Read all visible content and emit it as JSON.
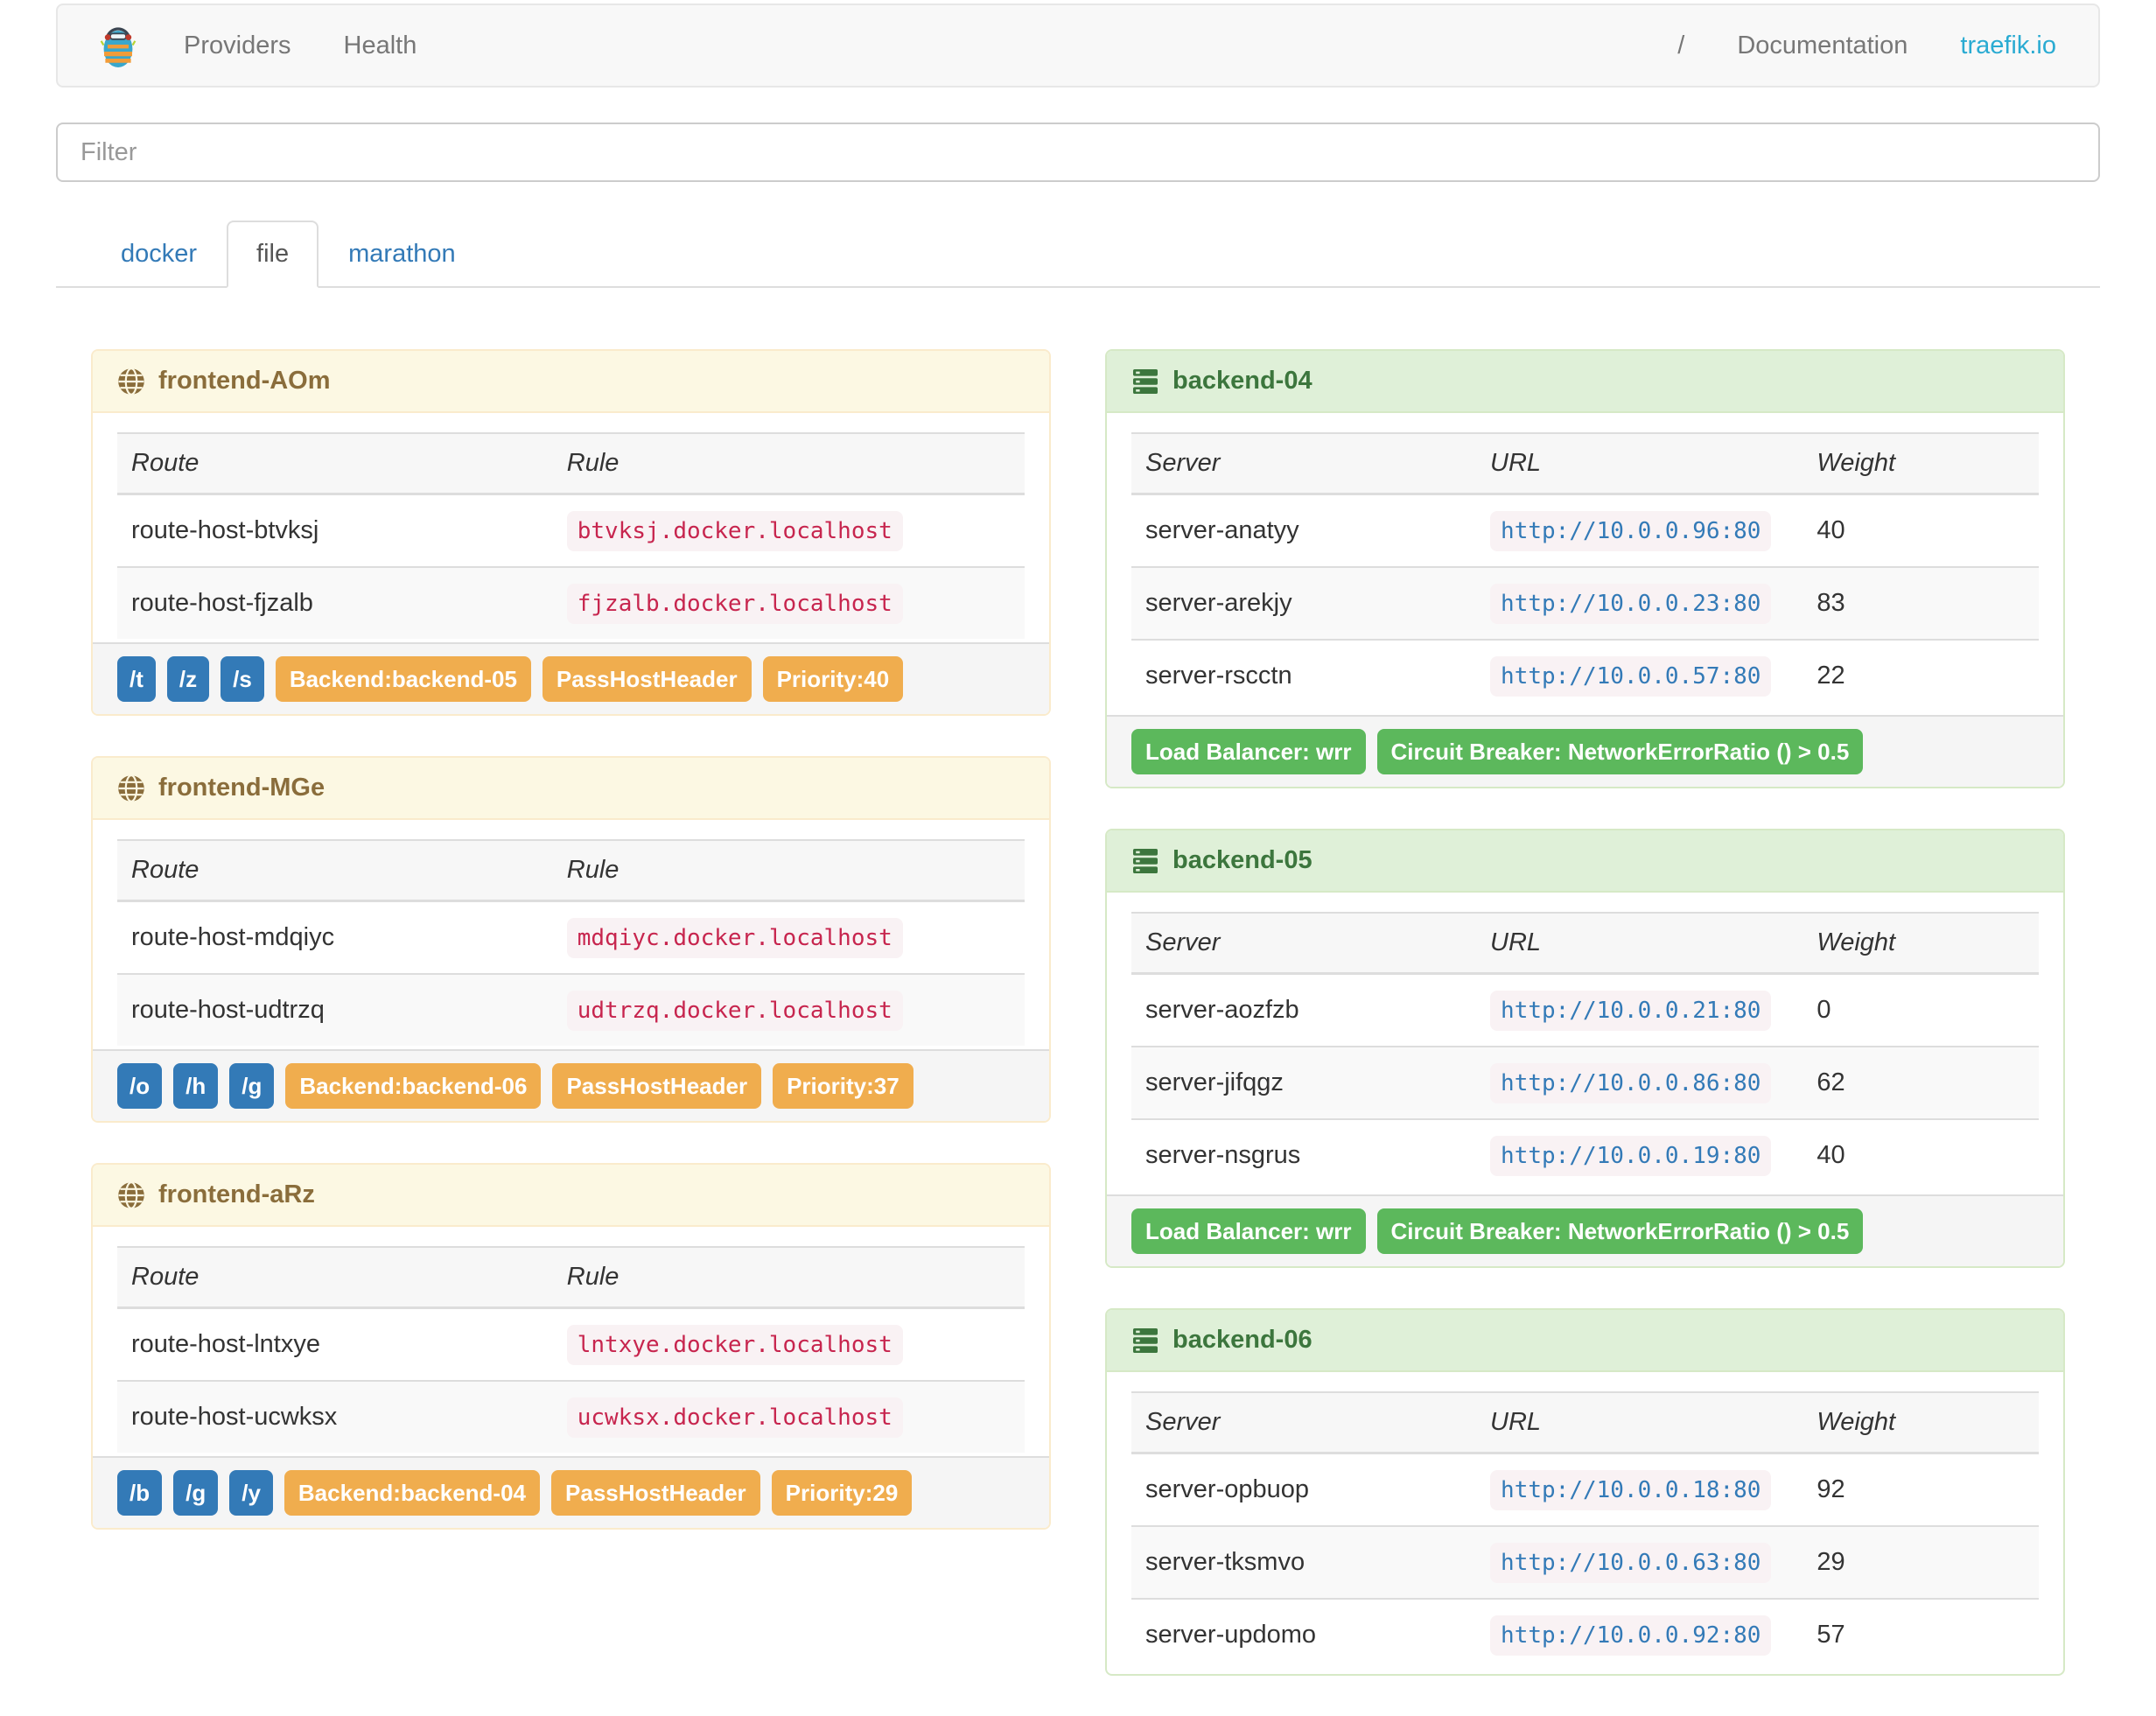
{
  "navbar": {
    "items_left": [
      "Providers",
      "Health"
    ],
    "version": "/",
    "items_right": [
      "Documentation",
      "traefik.io"
    ]
  },
  "filter": {
    "placeholder": "Filter"
  },
  "tabs": {
    "items": [
      {
        "label": "docker",
        "active": false
      },
      {
        "label": "file",
        "active": true
      },
      {
        "label": "marathon",
        "active": false
      }
    ]
  },
  "frontend_columns": [
    "Route",
    "Rule"
  ],
  "backend_columns": [
    "Server",
    "URL",
    "Weight"
  ],
  "frontends": [
    {
      "title": "frontend-AOm",
      "routes": [
        {
          "route": "route-host-btvksj",
          "rule": "btvksj.docker.localhost"
        },
        {
          "route": "route-host-fjzalb",
          "rule": "fjzalb.docker.localhost"
        }
      ],
      "entry_points": [
        "/t",
        "/z",
        "/s"
      ],
      "badges": [
        "Backend:backend-05",
        "PassHostHeader",
        "Priority:40"
      ]
    },
    {
      "title": "frontend-MGe",
      "routes": [
        {
          "route": "route-host-mdqiyc",
          "rule": "mdqiyc.docker.localhost"
        },
        {
          "route": "route-host-udtrzq",
          "rule": "udtrzq.docker.localhost"
        }
      ],
      "entry_points": [
        "/o",
        "/h",
        "/g"
      ],
      "badges": [
        "Backend:backend-06",
        "PassHostHeader",
        "Priority:37"
      ]
    },
    {
      "title": "frontend-aRz",
      "routes": [
        {
          "route": "route-host-lntxye",
          "rule": "lntxye.docker.localhost"
        },
        {
          "route": "route-host-ucwksx",
          "rule": "ucwksx.docker.localhost"
        }
      ],
      "entry_points": [
        "/b",
        "/g",
        "/y"
      ],
      "badges": [
        "Backend:backend-04",
        "PassHostHeader",
        "Priority:29"
      ]
    }
  ],
  "backends": [
    {
      "title": "backend-04",
      "servers": [
        {
          "server": "server-anatyy",
          "url": "http://10.0.0.96:80",
          "weight": "40"
        },
        {
          "server": "server-arekjy",
          "url": "http://10.0.0.23:80",
          "weight": "83"
        },
        {
          "server": "server-rscctn",
          "url": "http://10.0.0.57:80",
          "weight": "22"
        }
      ],
      "badges": [
        "Load Balancer: wrr",
        "Circuit Breaker: NetworkErrorRatio () > 0.5"
      ]
    },
    {
      "title": "backend-05",
      "servers": [
        {
          "server": "server-aozfzb",
          "url": "http://10.0.0.21:80",
          "weight": "0"
        },
        {
          "server": "server-jifqgz",
          "url": "http://10.0.0.86:80",
          "weight": "62"
        },
        {
          "server": "server-nsgrus",
          "url": "http://10.0.0.19:80",
          "weight": "40"
        }
      ],
      "badges": [
        "Load Balancer: wrr",
        "Circuit Breaker: NetworkErrorRatio () > 0.5"
      ]
    },
    {
      "title": "backend-06",
      "servers": [
        {
          "server": "server-opbuop",
          "url": "http://10.0.0.18:80",
          "weight": "92"
        },
        {
          "server": "server-tksmvo",
          "url": "http://10.0.0.63:80",
          "weight": "29"
        },
        {
          "server": "server-updomo",
          "url": "http://10.0.0.92:80",
          "weight": "57"
        }
      ]
    }
  ],
  "colors": {
    "accent_blue": "#337ab7",
    "label_orange": "#f0ad4e",
    "label_green": "#5cb85c",
    "frontend_header_bg": "#fcf8e3",
    "frontend_header_text": "#8a6d3b",
    "frontend_border": "#faebcc",
    "backend_header_bg": "#dff0d8",
    "backend_header_text": "#3c763d",
    "backend_border": "#d6e9c6",
    "rule_code_text": "#c7254e",
    "code_bg": "#f9f2f4"
  },
  "icons": {
    "logo": "traefik-mascot-logo",
    "frontend": "globe-icon",
    "backend": "server-icon"
  }
}
